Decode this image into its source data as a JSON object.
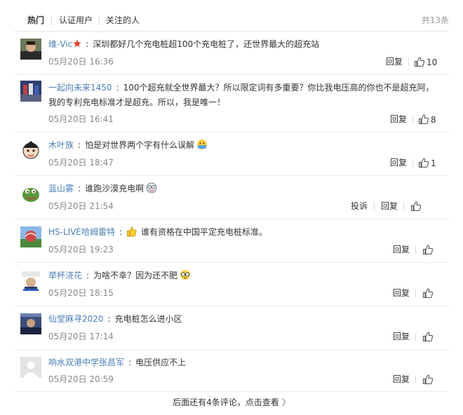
{
  "tabs": {
    "hot": "热门",
    "verified": "认证用户",
    "following": "关注的人",
    "total": "共13条"
  },
  "comments": [
    {
      "user": "维-Vic",
      "text": "深圳都好几个充电桩超100个充电桩了，还世界最大的超充站",
      "time": "05月20日 16:36",
      "reply": "回复",
      "likes": "10"
    },
    {
      "user": "一起向未来1450",
      "text": "100个超充就全世界最大？所以限定词有多重要？你比我电压高的你也不是超充阿，我的专利充电标准才是超充。所以，我是唯一！",
      "time": "05月20日 16:41",
      "reply": "回复",
      "likes": "8"
    },
    {
      "user": "木叶族",
      "text": "怕是对世界两个字有什么误解",
      "time": "05月20日 18:47",
      "reply": "回复",
      "likes": "1"
    },
    {
      "user": "蓝山雾",
      "text": "谁跑沙漠充电啊",
      "time": "05月20日 21:54",
      "report": "投诉",
      "reply": "回复",
      "likes": ""
    },
    {
      "user": "HS-LIVE哈姆雷特",
      "text": "谁有资格在中国平定充电桩标准。",
      "time": "05月20日 19:23",
      "reply": "回复",
      "likes": ""
    },
    {
      "user": "举杯浇花",
      "text": "为啥不幸？因为还不肥",
      "time": "05月20日 18:15",
      "reply": "回复",
      "likes": ""
    },
    {
      "user": "仙堂麻寻2020",
      "text": "充电桩怎么进小区",
      "time": "05月20日 17:14",
      "reply": "回复",
      "likes": ""
    },
    {
      "user": "响水双港中学张昌军",
      "text": "电压供应不上",
      "time": "05月20日 20:59",
      "reply": "回复",
      "likes": ""
    }
  ],
  "footer": {
    "more_text": "后面还有4条评论，点击查看",
    "chevron": "〉"
  },
  "colors": {
    "username_orange": "#eb7350",
    "username_blue": "#4b7fb5",
    "vip_star": "#e8402e"
  }
}
